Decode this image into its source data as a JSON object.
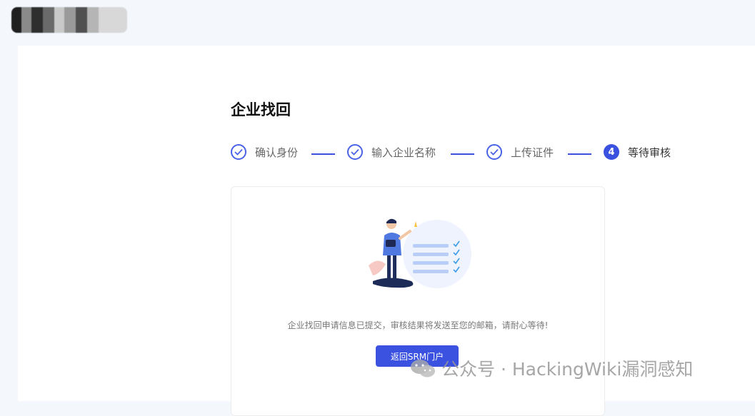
{
  "header": {
    "logo_blur_colors": [
      "#1f1f1f",
      "#8a8a8a",
      "#2e2e2e",
      "#6a6a6a",
      "#c9c9c9",
      "#9a9a9a",
      "#505050",
      "#b5b5b5",
      "#d8d8d8"
    ]
  },
  "page": {
    "title": "企业找回"
  },
  "steps": [
    {
      "label": "确认身份",
      "status": "done"
    },
    {
      "label": "输入企业名称",
      "status": "done"
    },
    {
      "label": "上传证件",
      "status": "done"
    },
    {
      "label": "等待审核",
      "status": "active",
      "number": "4"
    }
  ],
  "result": {
    "message": "企业找回申请信息已提交，审核结果将发送至您的邮箱，请耐心等待!",
    "button_label": "返回SRM门户"
  },
  "watermark": {
    "text": "公众号 · HackingWiki漏洞感知",
    "icon": "wechat-icon"
  },
  "colors": {
    "accent": "#3b52e0",
    "page_bg": "#f4f7fc"
  }
}
